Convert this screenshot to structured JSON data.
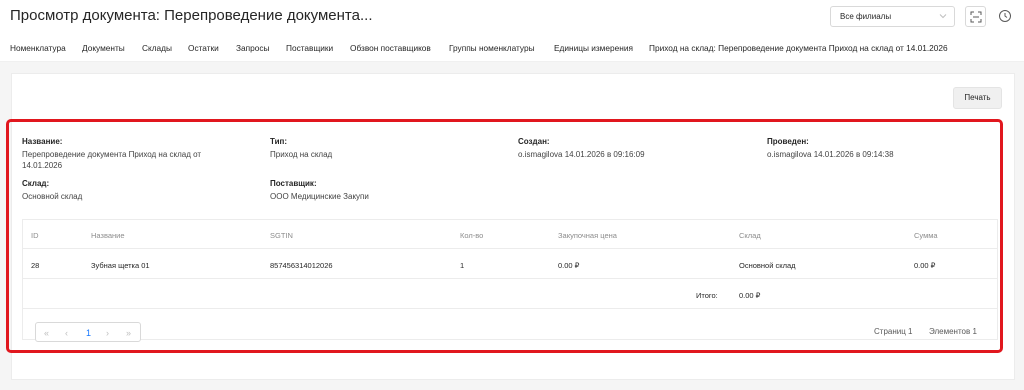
{
  "header": {
    "title": "Просмотр документа: Перепроведение документа...",
    "branch_select_value": "Все филиалы"
  },
  "nav": {
    "items": [
      "Номенклатура",
      "Документы",
      "Склады",
      "Остатки",
      "Запросы",
      "Поставщики",
      "Обзвон поставщиков",
      "Группы номенклатуры",
      "Единицы измерения",
      "Приход на склад: Перепроведение документа Приход на склад от 14.01.2026"
    ]
  },
  "toolbar": {
    "print_label": "Печать"
  },
  "details": {
    "name_label": "Название:",
    "name_value_line1": "Перепроведение документа Приход на склад от",
    "name_value_line2": "14.01.2026",
    "type_label": "Тип:",
    "type_value": "Приход на склад",
    "created_label": "Создан:",
    "created_value": "o.ismagilova 14.01.2026 в 09:16:09",
    "posted_label": "Проведен:",
    "posted_value": "o.ismagilova 14.01.2026 в 09:14:38",
    "warehouse_label": "Склад:",
    "warehouse_value": "Основной склад",
    "supplier_label": "Поставщик:",
    "supplier_value": "ООО Медицинские Закупи"
  },
  "table": {
    "columns": [
      "ID",
      "Название",
      "SGTIN",
      "Кол-во",
      "Закупочная цена",
      "Склад",
      "Сумма"
    ],
    "rows": [
      [
        "28",
        "Зубная щетка 01",
        "857456314012026",
        "1",
        "0.00 ₽",
        "Основной склад",
        "0.00 ₽"
      ]
    ],
    "total_label": "Итого:",
    "total_value": "0.00 ₽"
  },
  "pagination": {
    "current_page": "1",
    "pages_text": "Страниц 1",
    "elements_text": "Элементов 1"
  },
  "colors": {
    "highlight": "#e1171e",
    "accent": "#1677ff"
  }
}
